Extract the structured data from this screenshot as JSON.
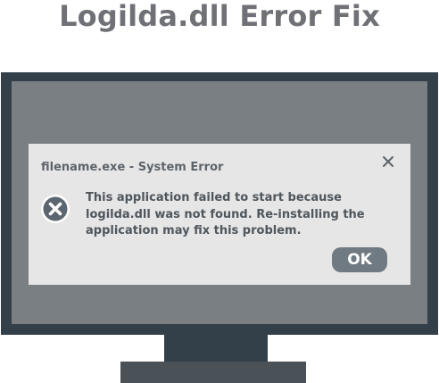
{
  "page": {
    "title": "Logilda.dll Error Fix"
  },
  "dialog": {
    "title": "filename.exe - System Error",
    "message": "This application failed to start because logilda.dll was not found. Re-installing the application may fix this problem.",
    "ok_label": "OK",
    "close_icon": "close-icon",
    "error_icon": "error-x-circle-icon"
  },
  "colors": {
    "title_text": "#6f7176",
    "monitor_bezel": "#333f49",
    "monitor_screen": "#7a7f84",
    "monitor_base": "#4a5157",
    "dialog_background": "#e6e6e6",
    "ok_button": "#6f7a82",
    "error_icon_fill": "#5c6670"
  }
}
